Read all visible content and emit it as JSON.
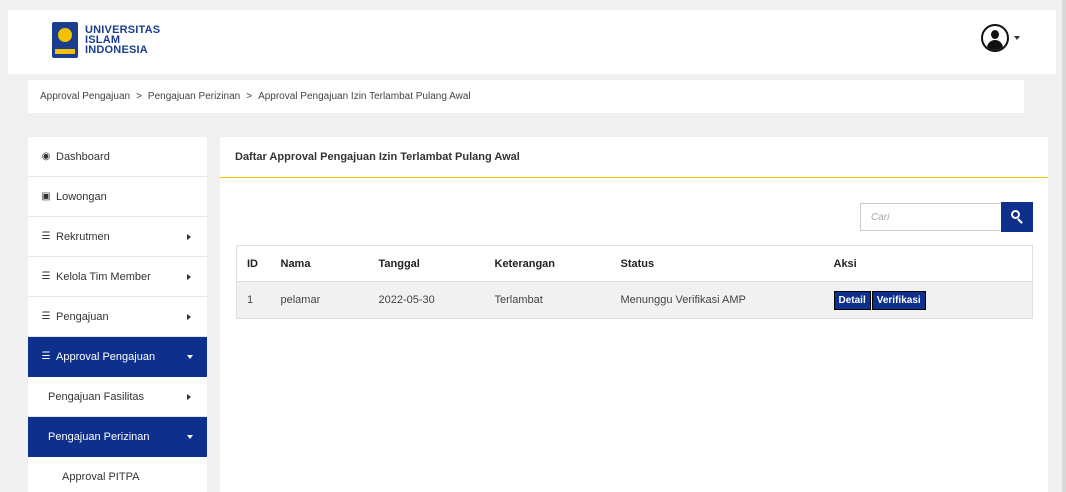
{
  "header": {
    "logo_line1": "UNIVERSITAS",
    "logo_line2": "ISLAM",
    "logo_line3": "INDONESIA",
    "user_icon": "user-circle-icon"
  },
  "breadcrumb": [
    "Approval Pengajuan",
    "Pengajuan Perizinan",
    "Approval Pengajuan Izin Terlambat Pulang Awal"
  ],
  "breadcrumb_separator": ">",
  "sidebar": {
    "items": [
      {
        "label": "Dashboard",
        "icon": "dashboard-icon"
      },
      {
        "label": "Lowongan",
        "icon": "briefcase-icon"
      },
      {
        "label": "Rekrutmen",
        "icon": "list-icon"
      },
      {
        "label": "Kelola Tim Member",
        "icon": "list-icon"
      },
      {
        "label": "Pengajuan",
        "icon": "list-icon"
      },
      {
        "label": "Approval Pengajuan",
        "icon": "list-icon"
      },
      {
        "label": "Pengajuan Fasilitas"
      },
      {
        "label": "Pengajuan Perizinan"
      },
      {
        "label": "Approval PITPA"
      }
    ]
  },
  "panel": {
    "title": "Daftar Approval Pengajuan Izin Terlambat Pulang Awal",
    "search_placeholder": "Cari"
  },
  "table": {
    "columns": [
      "ID",
      "Nama",
      "Tanggal",
      "Keterangan",
      "Status",
      "Aksi"
    ],
    "rows": [
      {
        "id": "1",
        "nama": "pelamar",
        "tanggal": "2022-05-30",
        "keterangan": "Terlambat",
        "status": "Menunggu Verifikasi AMP",
        "actions": [
          "Detail",
          "Verifikasi"
        ]
      }
    ]
  },
  "colors": {
    "primary": "#0e2f8c",
    "accent": "#f2c200",
    "background": "#f0f0f0"
  }
}
